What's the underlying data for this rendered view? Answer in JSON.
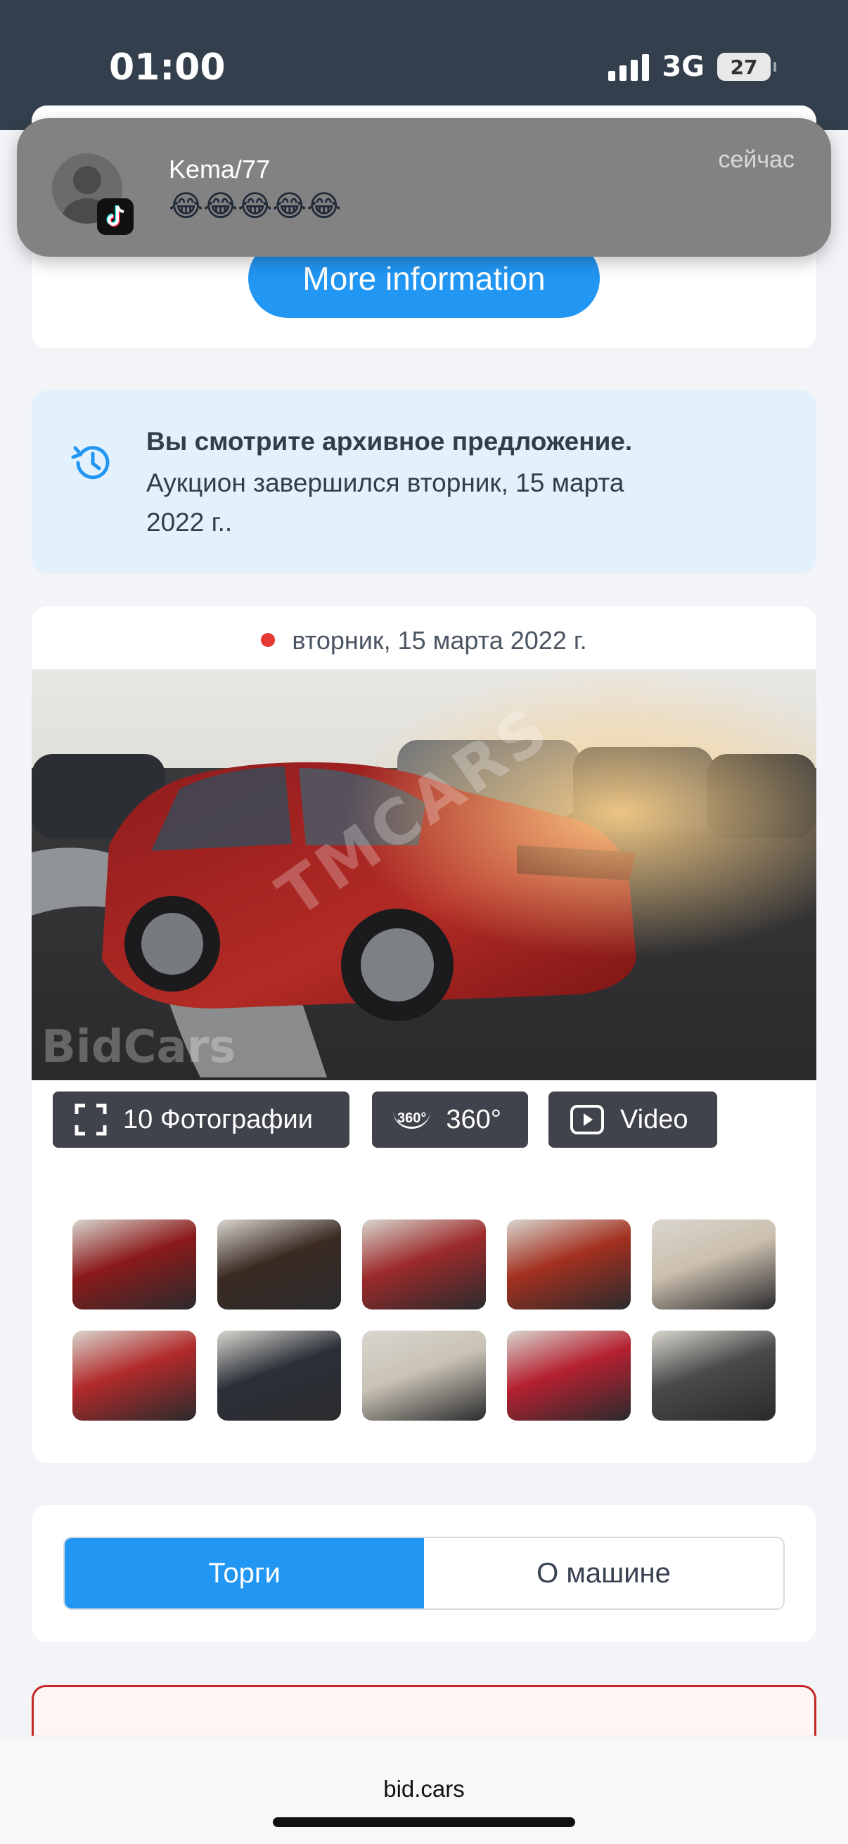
{
  "status_bar": {
    "time": "01:00",
    "network": "3G",
    "battery": "27"
  },
  "notification": {
    "app_icon": "tiktok-icon",
    "sender": "Kema/77",
    "message": "😂😂😂😂😂",
    "time": "сейчас"
  },
  "info_card": {
    "more_button": "More information"
  },
  "archive_notice": {
    "icon": "history-icon",
    "title": "Вы смотрите архивное предложение.",
    "text": "Аукцион завершился вторник, 15 марта 2022 г.."
  },
  "gallery": {
    "date": "вторник, 15 марта 2022 г.",
    "watermark": "TMCARS",
    "photo_logo": "BidCars",
    "photos_label": "10 Фотографии",
    "pano_badge": "360°",
    "pano_label": "360°",
    "video_label": "Video",
    "thumbnails": [
      {
        "name": "thumb-front-left",
        "color": "#8b1a1a"
      },
      {
        "name": "thumb-front-sun",
        "color": "#3a2a22"
      },
      {
        "name": "thumb-side",
        "color": "#9c2a2a"
      },
      {
        "name": "thumb-front-right",
        "color": "#a3301f"
      },
      {
        "name": "thumb-interior-dash",
        "color": "#cbbfae"
      },
      {
        "name": "thumb-rear-side",
        "color": "#b12a2a"
      },
      {
        "name": "thumb-gauges",
        "color": "#2b3038"
      },
      {
        "name": "thumb-seats",
        "color": "#c9c2b5"
      },
      {
        "name": "thumb-label",
        "color": "#b52030"
      },
      {
        "name": "thumb-engine",
        "color": "#4a4a4a"
      }
    ]
  },
  "tabs": {
    "active": "Торги",
    "inactive": "О машине"
  },
  "browser": {
    "url": "bid.cars"
  }
}
